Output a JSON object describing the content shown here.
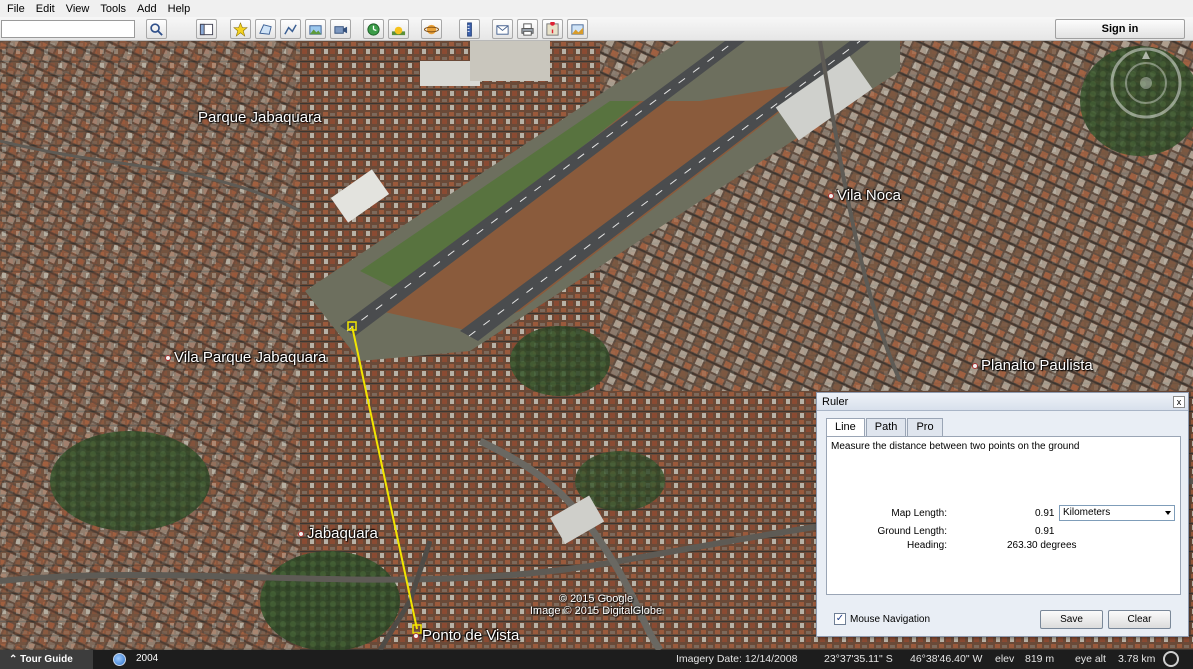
{
  "menu": [
    "File",
    "Edit",
    "View",
    "Tools",
    "Add",
    "Help"
  ],
  "toolbar": {
    "search_value": "",
    "sign_in_label": "Sign in",
    "buttons": [
      "search-icon",
      "sidebar-icon",
      "placemark-icon",
      "polygon-icon",
      "path-icon",
      "overlay-icon",
      "tour-icon",
      "historical-imagery-icon",
      "sunlight-icon",
      "planets-icon",
      "ruler-icon",
      "email-icon",
      "print-icon",
      "google-maps-icon",
      "save-image-icon"
    ]
  },
  "map": {
    "places": [
      "Parque Jabaquara",
      "Vila Noca",
      "Vila Parque Jabaquara",
      "Planalto Paulista",
      "Jabaquara",
      "Ponto de Vista"
    ],
    "copyright_line1": "© 2015 Google",
    "copyright_line2": "Image © 2015 DigitalGlobe",
    "measure_line_color": "#f2e600"
  },
  "ruler": {
    "title": "Ruler",
    "close": "x",
    "tabs": [
      "Line",
      "Path",
      "Pro"
    ],
    "active_tab": "Line",
    "description": "Measure the distance between two points on the ground",
    "map_length_label": "Map Length:",
    "map_length_value": "0.91",
    "unit": "Kilometers",
    "ground_length_label": "Ground Length:",
    "ground_length_value": "0.91",
    "heading_label": "Heading:",
    "heading_value": "263.30 degrees",
    "mouse_nav_label": "Mouse Navigation",
    "mouse_nav_checked": true,
    "save_label": "Save",
    "clear_label": "Clear"
  },
  "status": {
    "tour_guide": "Tour Guide",
    "year": "2004",
    "imagery_date": "Imagery Date: 12/14/2008",
    "lat": "23°37'35.11\" S",
    "lon": "46°38'46.40\" W",
    "elev_label": "elev",
    "elev_value": "819 m",
    "eye_alt_label": "eye alt",
    "eye_alt_value": "3.78 km"
  }
}
